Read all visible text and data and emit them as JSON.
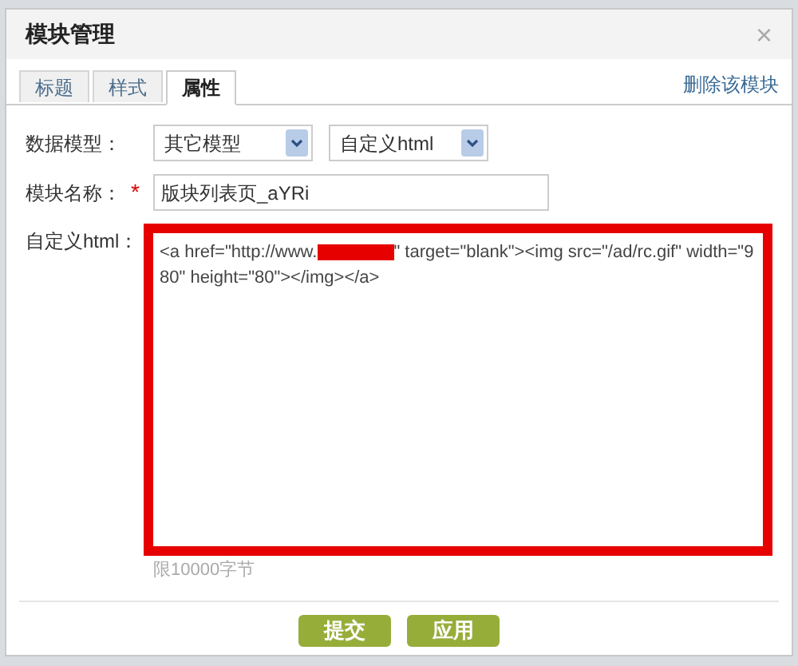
{
  "window": {
    "title": "模块管理",
    "close": "×"
  },
  "tabs": [
    {
      "label": "标题",
      "selected": false
    },
    {
      "label": "样式",
      "selected": false
    },
    {
      "label": "属性",
      "selected": true
    }
  ],
  "delete_link": "删除该模块",
  "data_model": {
    "label": "数据模型：",
    "selects": [
      {
        "value": "其它模型"
      },
      {
        "value": "自定义html"
      }
    ]
  },
  "module_name": {
    "label": "模块名称：",
    "required": true,
    "required_mark": "*",
    "value": "版块列表页_aYRi"
  },
  "custom_html": {
    "label": "自定义html：",
    "value_before": "<a href=\"http://www.",
    "value_after": "\"  target=\"blank\"><img src=\"/ad/rc.gif\" width=\"980\" height=\"80\"></img></a>",
    "highlighted": true,
    "hint": "限10000字节"
  },
  "buttons": [
    "提交",
    "应用"
  ]
}
